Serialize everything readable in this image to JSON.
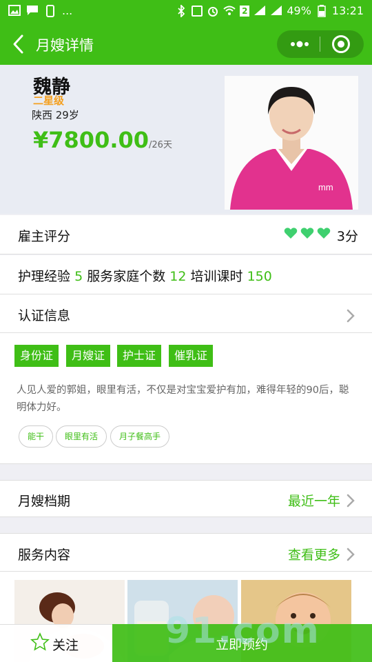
{
  "status_bar": {
    "dots": "...",
    "battery_percent": "49%",
    "time": "13:21",
    "sim_badge": "2",
    "icons": [
      "image-icon",
      "chat-icon",
      "phone-icon",
      "bluetooth-icon",
      "nfc-icon",
      "alarm-icon",
      "wifi-icon",
      "signal-icon",
      "battery-icon"
    ]
  },
  "nav": {
    "title": "月嫂详情",
    "back_icon": "chevron-left-icon",
    "more_icon": "more-dots-icon",
    "close_icon": "target-circle-icon"
  },
  "profile": {
    "name": "魏静",
    "level": "二星级",
    "location_age": "陕西 29岁",
    "price": "¥7800.00",
    "price_unit": "/26天"
  },
  "rating": {
    "label": "雇主评分",
    "hearts": 3,
    "score": "3分"
  },
  "experience": {
    "exp_label": "护理经验",
    "exp_value": "5",
    "families_label": "服务家庭个数",
    "families_value": "12",
    "training_label": "培训课时",
    "training_value": "150"
  },
  "certification": {
    "label": "认证信息",
    "certs": [
      "身份证",
      "月嫂证",
      "护士证",
      "催乳证"
    ],
    "description": "人见人爱的郭姐，眼里有活，不仅是对宝宝爱护有加，难得年轻的90后，聪明体力好。",
    "tags": [
      "能干",
      "眼里有活",
      "月子餐高手"
    ]
  },
  "schedule": {
    "label": "月嫂档期",
    "value": "最近一年"
  },
  "service": {
    "label": "服务内容",
    "more": "查看更多"
  },
  "bottom": {
    "follow_label": "关注",
    "reserve_label": "立即预约"
  },
  "watermark": "91.com",
  "colors": {
    "brand_green": "#3fbe16",
    "level_orange": "#f4a020",
    "heart_green": "#3fd06f"
  }
}
